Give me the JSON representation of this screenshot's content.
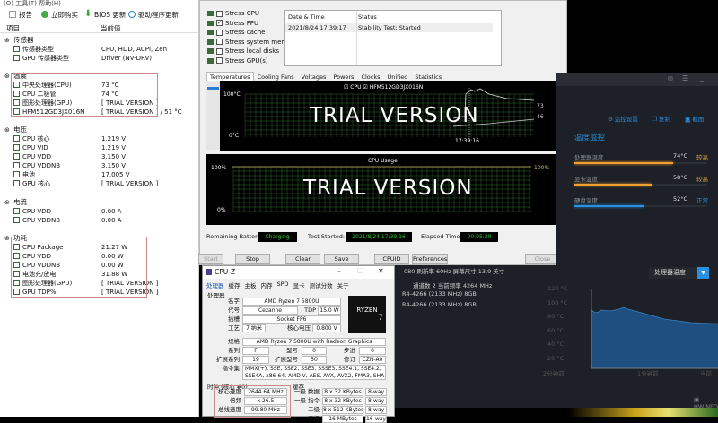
{
  "hwinfo": {
    "menu": "(O)  工具(T)  帮助(H)",
    "toolbar": [
      "报告",
      "立即购买",
      "BIOS 更新",
      "驱动程序更新"
    ],
    "columns": [
      "项目",
      "当前值"
    ],
    "groups": [
      {
        "title": "传感器",
        "rows": [
          [
            "传感器类型",
            "CPU, HDD, ACPI, Zen"
          ],
          [
            "GPU 传感器类型",
            "Driver  (NV-DRV)"
          ]
        ]
      },
      {
        "title": "温度",
        "rows": [
          [
            "中央处理器(CPU)",
            "73 °C"
          ],
          [
            "CPU 二极管",
            "74 °C"
          ],
          [
            "图形处理器(GPU)",
            "[ TRIAL VERSION ]"
          ],
          [
            "HFM512GD3JX016N",
            "[ TRIAL VERSION ] / 51 °C"
          ]
        ]
      },
      {
        "title": "电压",
        "rows": [
          [
            "CPU 核心",
            "1.219 V"
          ],
          [
            "CPU VID",
            "1.219 V"
          ],
          [
            "CPU VDD",
            "3.150 V"
          ],
          [
            "CPU VDDNB",
            "3.150 V"
          ],
          [
            "电池",
            "17.005 V"
          ],
          [
            "GPU 核心",
            "[ TRIAL VERSION ]"
          ]
        ]
      },
      {
        "title": "电流",
        "rows": [
          [
            "CPU VDD",
            "0.00 A"
          ],
          [
            "CPU VDDNB",
            "0.00 A"
          ]
        ]
      },
      {
        "title": "功耗",
        "rows": [
          [
            "CPU Package",
            "21.27 W"
          ],
          [
            "CPU VDD",
            "0.00 W"
          ],
          [
            "CPU VDDNB",
            "0.00 W"
          ],
          [
            "电池充/放电",
            "31.88 W"
          ],
          [
            "图形处理器(GPU)",
            "[ TRIAL VERSION ]"
          ],
          [
            "GPU TDP%",
            "[ TRIAL VERSION ]"
          ]
        ]
      }
    ]
  },
  "stress": {
    "checks": [
      {
        "label": "Stress CPU",
        "checked": false
      },
      {
        "label": "Stress FPU",
        "checked": true
      },
      {
        "label": "Stress cache",
        "checked": false
      },
      {
        "label": "Stress system memory",
        "checked": false
      },
      {
        "label": "Stress local disks",
        "checked": false
      },
      {
        "label": "Stress GPU(s)",
        "checked": false
      }
    ],
    "log_headers": [
      "Date & Time",
      "Status"
    ],
    "log_rows": [
      [
        "2021/8/24 17:39:17",
        "Stability Test: Started"
      ]
    ],
    "tabs": [
      "Temperatures",
      "Cooling Fans",
      "Voltages",
      "Powers",
      "Clocks",
      "Unified",
      "Statistics"
    ],
    "temp_graph": {
      "legend": [
        "CPU",
        "HFM512GD3JX016N"
      ],
      "ymax": "100°C",
      "ymin": "0°C",
      "time": "17:39:16",
      "watermark": "TRIAL VERSION",
      "v1": "73",
      "v2": "46"
    },
    "usage_graph": {
      "title": "CPU Usage",
      "ymax": "100%",
      "ymin": "0%",
      "right": "100%",
      "watermark": "TRIAL VERSION"
    },
    "status": {
      "battery_label": "Remaining Battery:",
      "battery": "Charging",
      "started_label": "Test Started:",
      "started": "2021/8/24 17:39:16",
      "elapsed_label": "Elapsed Time:",
      "elapsed": "00:05:20"
    },
    "buttons": [
      "Start",
      "Stop",
      "Clear",
      "Save",
      "CPUID",
      "Preferences",
      "Close"
    ]
  },
  "cpuz": {
    "title": "CPU-Z",
    "tabs": [
      "处理器",
      "缓存",
      "主板",
      "内存",
      "SPD",
      "显卡",
      "测试分数",
      "关于"
    ],
    "section": "处理器",
    "name_label": "名字",
    "name": "AMD Ryzen 7 5800U",
    "code_label": "代号",
    "code": "Cezanne",
    "tdp_label": "TDP",
    "tdp": "15.0 W",
    "socket_label": "插槽",
    "socket": "Socket FP6",
    "tech_label": "工艺",
    "tech": "7 纳米",
    "volt_label": "核心电压",
    "volt": "0.800 V",
    "spec_label": "规格",
    "spec": "AMD Ryzen 7 5800U with Radeon Graphics",
    "family_label": "系列",
    "family": "F",
    "model_label": "型号",
    "model": "0",
    "step_label": "步进",
    "step": "0",
    "extfam_label": "扩展系列",
    "extfam": "19",
    "extmod_label": "扩展型号",
    "extmod": "50",
    "rev_label": "修订",
    "rev": "CZN-A0",
    "instr_label": "指令集",
    "instr": "MMX(+), SSE, SSE2, SSE3, SSSE3, SSE4.1, SSE4.2, SSE4A, x86-64, AMD-V, AES, AVX, AVX2, FMA3, SHA",
    "clock_section": "时钟 (核心 #0)",
    "cache_section": "缓存",
    "clocks": [
      [
        "核心速度",
        "2644.64 MHz"
      ],
      [
        "倍频",
        "x 26.5"
      ],
      [
        "总线速度",
        "99.80 MHz"
      ]
    ],
    "cache": [
      [
        "一级 数据",
        "8 x 32 KBytes",
        "8-way"
      ],
      [
        "一级 指令",
        "8 x 32 KBytes",
        "8-way"
      ],
      [
        "二级",
        "8 x 512 KBytes",
        "8-way"
      ],
      [
        "三级",
        "16 MBytes",
        "16-way"
      ]
    ],
    "logo": "RYZEN 7"
  },
  "monitor": {
    "actions": [
      "监控设置",
      "复制",
      "截图"
    ],
    "title": "温度监控",
    "items": [
      {
        "label": "处理器温度",
        "value": "74°C",
        "status": "较高",
        "pct": 0.74,
        "color": "#f0a030"
      },
      {
        "label": "显卡温度",
        "value": "58°C",
        "status": "较高",
        "pct": 0.58,
        "color": "#f0a030"
      },
      {
        "label": "硬盘温度",
        "value": "52°C",
        "status": "正常",
        "pct": 0.52,
        "color": "#2a8fe0"
      }
    ],
    "info1": "080   刷新率 60Hz   屏幕尺寸  13.9 英寸",
    "info2": "通道数  2    当前频率  4264 MHz",
    "mem1": "R4-4266 (2133 MHz) 8GB",
    "mem2": "R4-4266 (2133 MHz) 8GB",
    "dropdown": "处理器温度",
    "chart_y": [
      "120 °C",
      "100 °C",
      "80 °C",
      "60 °C",
      "40 °C",
      "20 °C"
    ],
    "chart_x": [
      "2分钟前",
      "1分钟前",
      "当前"
    ],
    "brand": "HWINFO"
  }
}
